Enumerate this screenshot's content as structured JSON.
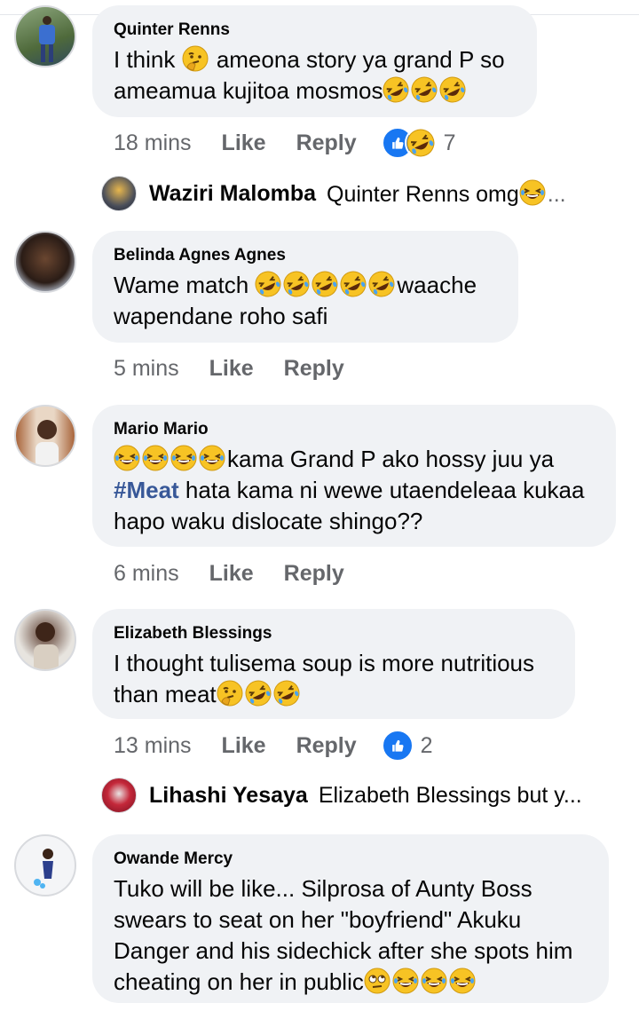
{
  "comments": [
    {
      "author": "Quinter Renns",
      "line1a": "I think ",
      "line1b": " ameona story ya grand P so",
      "line2": "ameamua kujitoa mosmos",
      "time": "18 mins",
      "like": "Like",
      "reply": "Reply",
      "reaction_count": "7"
    },
    {
      "author": "Belinda Agnes Agnes",
      "line1a": "Wame match ",
      "line1b": "waache",
      "line2": "wapendane roho safi",
      "time": "5 mins",
      "like": "Like",
      "reply": "Reply"
    },
    {
      "author": "Mario Mario",
      "line1": "kama Grand P ako hossy juu ya",
      "hashtag": "#Meat",
      "line2": " hata kama ni wewe utaendeleaa kukaa",
      "line3": "hapo waku dislocate shingo??",
      "time": "6 mins",
      "like": "Like",
      "reply": "Reply"
    },
    {
      "author": "Elizabeth Blessings",
      "line1": "I thought tulisema soup is more nutritious",
      "line2": "than meat",
      "time": "13 mins",
      "like": "Like",
      "reply": "Reply",
      "reaction_count": "2"
    },
    {
      "author": "Owande Mercy",
      "line1": "Tuko will be like... Silprosa of Aunty Boss",
      "line2": "swears to seat on her \"boyfriend\" Akuku",
      "line3": "Danger and his sidechick after she spots him",
      "line4": "cheating on her in public"
    }
  ],
  "replies": [
    {
      "author": "Waziri Malomba",
      "text": "Quinter Renns omg",
      "ellipsis": "..."
    },
    {
      "author": "Lihashi Yesaya",
      "text": "Elizabeth Blessings but y..."
    }
  ],
  "colors": {
    "bubble": "#f0f2f5",
    "like_blue": "#1877f2",
    "meta_gray": "#65676b",
    "hashtag": "#385898"
  }
}
